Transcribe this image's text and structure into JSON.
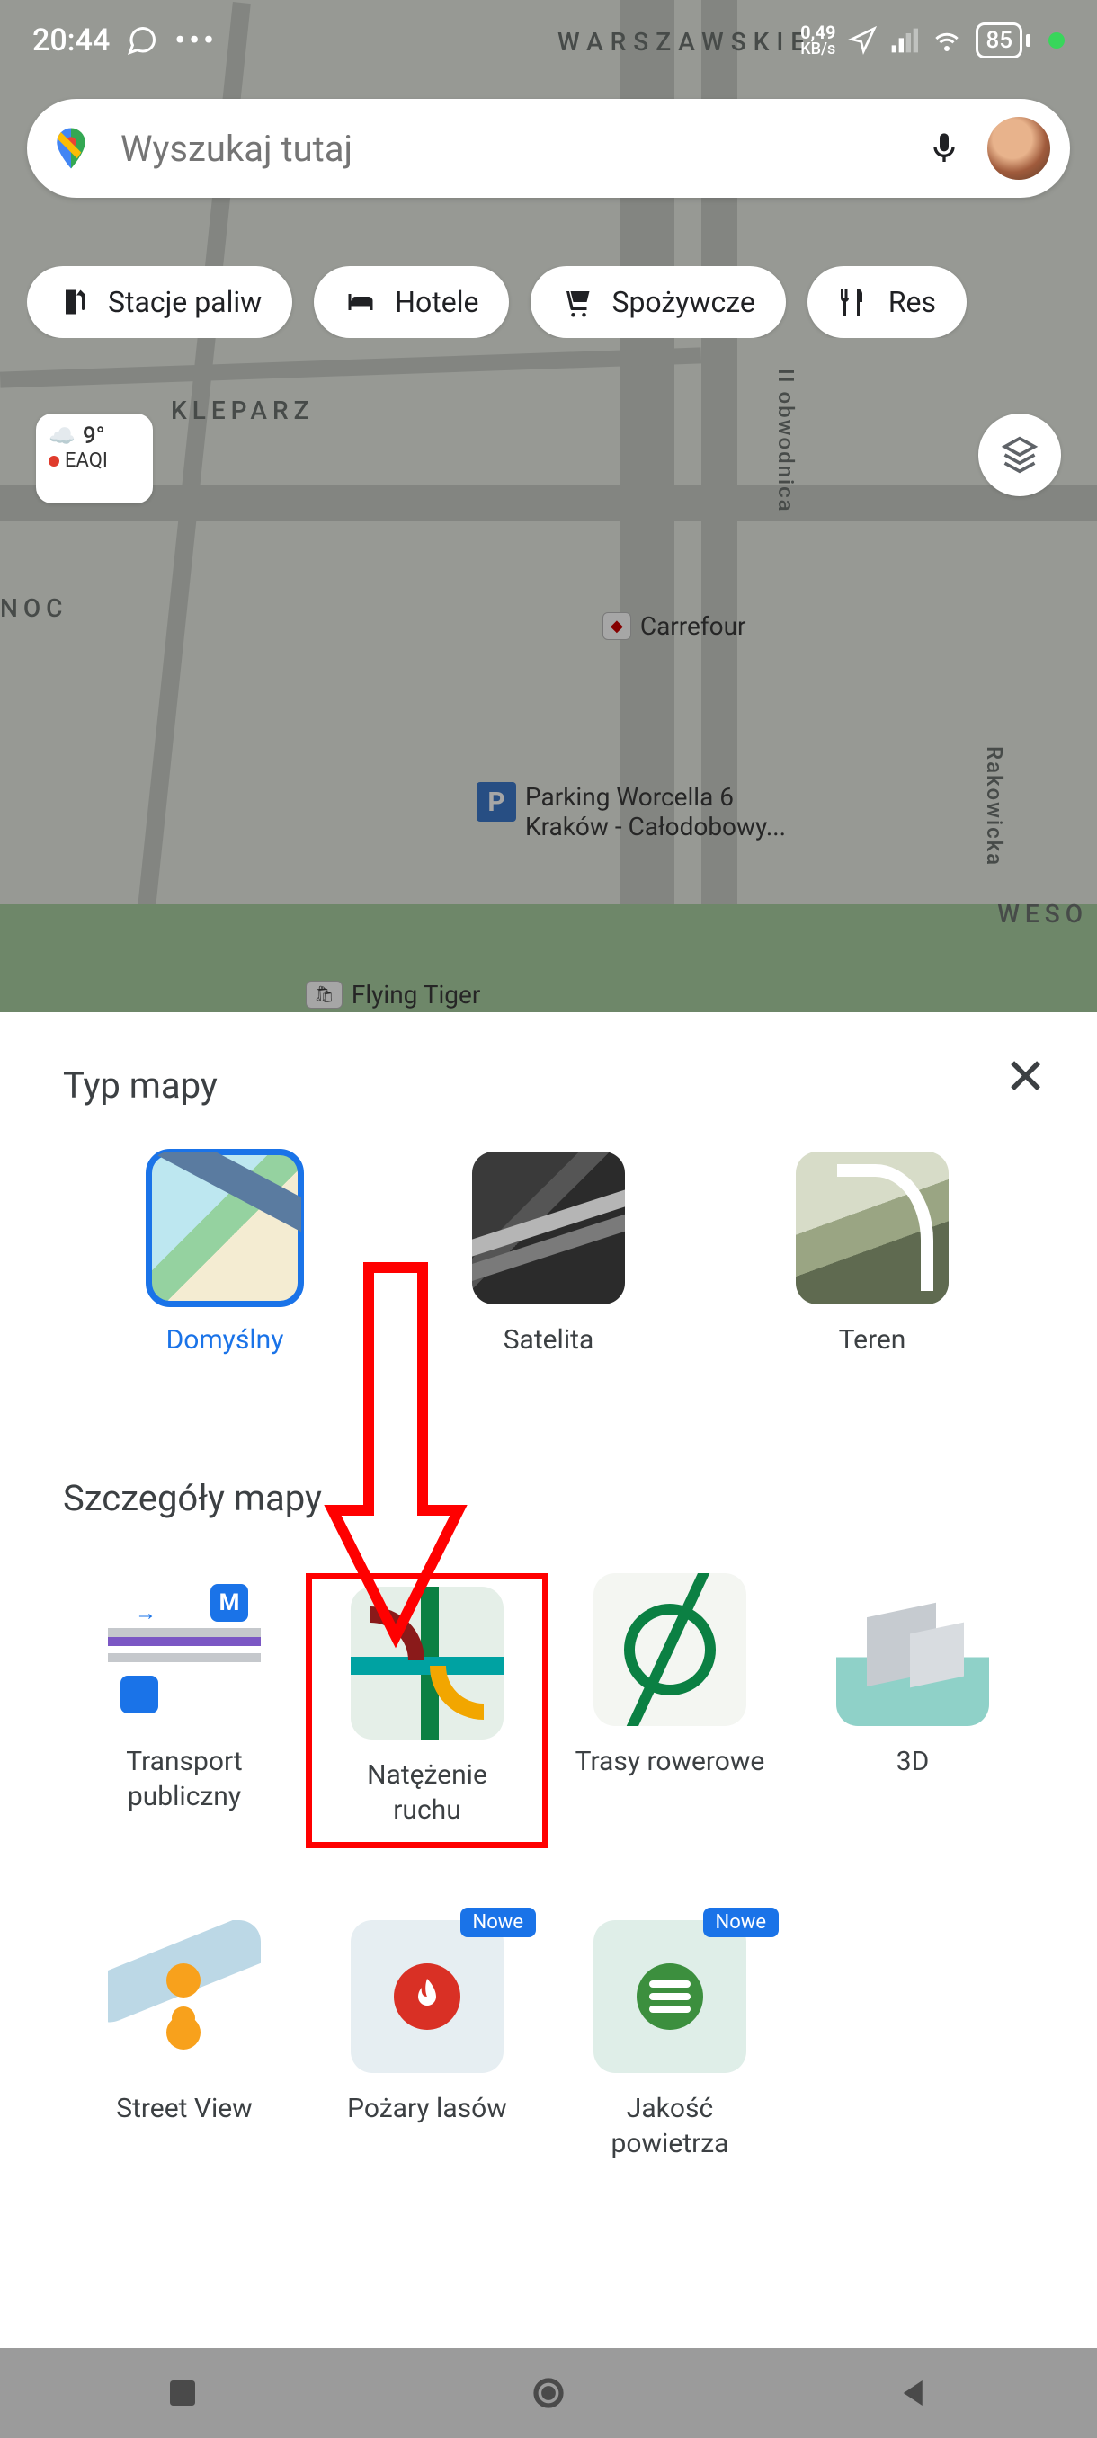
{
  "status": {
    "time": "20:44",
    "kbs_value": "0,49",
    "kbs_unit": "KB/s",
    "battery": "85"
  },
  "search": {
    "placeholder": "Wyszukaj tutaj"
  },
  "chips": {
    "gas": "Stacje paliw",
    "hotels": "Hotele",
    "grocery": "Spożywcze",
    "restaurants": "Res"
  },
  "weather": {
    "temp": "9°",
    "eaqi": "EAQI"
  },
  "map_labels": {
    "top_district": "WARSZAWSKIE",
    "kleparz": "KLEPARZ",
    "noc": "NOC",
    "wesol": "WESO",
    "ring_road": "II obwodnica",
    "rakowicka": "Rakowicka",
    "carrefour": "Carrefour",
    "parking_l1": "Parking Worcella 6",
    "parking_l2": "Kraków - Całodobowy...",
    "flying_tiger": "Flying Tiger"
  },
  "sheet": {
    "map_type_title": "Typ mapy",
    "map_details_title": "Szczegóły mapy",
    "types": {
      "default": "Domyślny",
      "satellite": "Satelita",
      "terrain": "Teren"
    },
    "details": {
      "transit_l1": "Transport",
      "transit_l2": "publiczny",
      "traffic_l1": "Natężenie",
      "traffic_l2": "ruchu",
      "bike": "Trasy rowerowe",
      "three_d": "3D",
      "streetview": "Street View",
      "wildfires": "Pożary lasów",
      "air_l1": "Jakość",
      "air_l2": "powietrza"
    },
    "badge_new": "Nowe"
  }
}
